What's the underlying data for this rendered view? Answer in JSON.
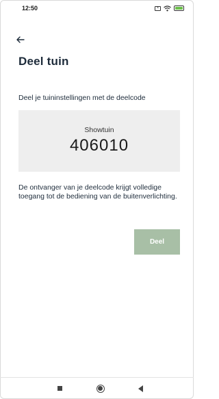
{
  "status_bar": {
    "time": "12:50",
    "icons": [
      "mute-icon",
      "wifi-icon",
      "battery-icon"
    ],
    "battery_color": "#6cc04a"
  },
  "header": {
    "back_icon": "arrow-left-icon",
    "title": "Deel tuin"
  },
  "main": {
    "intro": "Deel je tuininstellingen met de deelcode",
    "garden_name": "Showtuin",
    "share_code": "406010",
    "info": "De ontvanger van je deelcode krijgt volledige toegang tot de bediening van de buitenverlichting.",
    "share_button_label": "Deel"
  },
  "nav_bar": {
    "items": [
      "recents-icon",
      "home-icon",
      "back-icon"
    ]
  },
  "colors": {
    "text": "#1d2b3a",
    "code_box_bg": "#eeeeee",
    "button_bg": "#a8bfa6",
    "button_text": "#ffffff"
  }
}
